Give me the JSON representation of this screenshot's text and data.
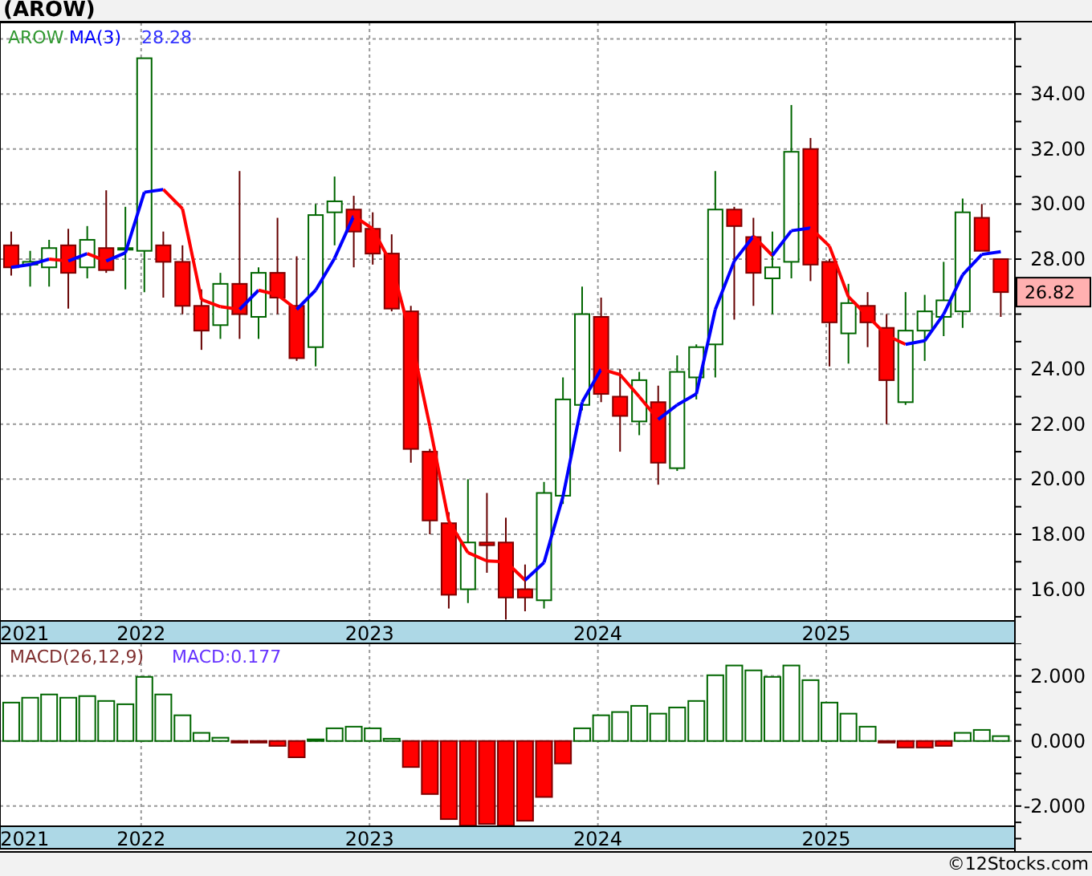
{
  "title": "(AROW)",
  "price_panel": {
    "legend": [
      {
        "text": "AROW",
        "color": "#339933"
      },
      {
        "text": "28.28",
        "color": "#3333ff"
      }
    ],
    "last_price": "26.82",
    "chart_data": {
      "type": "candlestick",
      "grid": true,
      "ylim": [
        14.85,
        36.6
      ],
      "xlim": [
        2021.382,
        2025.826
      ],
      "yticks": [
        {
          "value": 16,
          "label": "16.00"
        },
        {
          "value": 18,
          "label": "18.00"
        },
        {
          "value": 20,
          "label": "20.00"
        },
        {
          "value": 22,
          "label": "22.00"
        },
        {
          "value": 24,
          "label": "24.00"
        },
        {
          "value": 28,
          "label": "28.00"
        },
        {
          "value": 30,
          "label": "30.00"
        },
        {
          "value": 32,
          "label": "32.00"
        },
        {
          "value": 34,
          "label": "34.00"
        }
      ],
      "xticks": [
        {
          "value": 2021.49,
          "label": "2021"
        },
        {
          "value": 2022,
          "label": "2022"
        },
        {
          "value": 2023,
          "label": "2023"
        },
        {
          "value": 2024,
          "label": "2024"
        },
        {
          "value": 2025,
          "label": "2025"
        }
      ],
      "x": [
        2021.417,
        2021.5,
        2021.583,
        2021.667,
        2021.75,
        2021.833,
        2021.917,
        2022,
        2022.083,
        2022.167,
        2022.25,
        2022.333,
        2022.417,
        2022.5,
        2022.583,
        2022.667,
        2022.75,
        2022.833,
        2022.917,
        2023,
        2023.083,
        2023.167,
        2023.25,
        2023.333,
        2023.417,
        2023.5,
        2023.583,
        2023.667,
        2023.75,
        2023.833,
        2023.917,
        2024,
        2024.083,
        2024.167,
        2024.25,
        2024.333,
        2024.417,
        2024.5,
        2024.583,
        2024.667,
        2024.75,
        2024.833,
        2024.917,
        2025,
        2025.083,
        2025.167,
        2025.25,
        2025.333,
        2025.417,
        2025.5,
        2025.583,
        2025.667,
        2025.75
      ],
      "ohlc": [
        [
          28.5,
          29.0,
          27.4,
          27.7
        ],
        [
          27.8,
          28.3,
          27.0,
          27.9
        ],
        [
          27.7,
          28.7,
          27.0,
          28.4
        ],
        [
          28.5,
          29.1,
          26.2,
          27.5
        ],
        [
          27.7,
          29.2,
          27.3,
          28.7
        ],
        [
          28.4,
          30.5,
          27.5,
          27.6
        ],
        [
          28.35,
          29.9,
          26.9,
          28.4
        ],
        [
          28.3,
          35.3,
          26.8,
          35.3
        ],
        [
          28.5,
          29.0,
          26.6,
          27.9
        ],
        [
          27.9,
          28.5,
          26.0,
          26.3
        ],
        [
          26.3,
          26.9,
          24.7,
          25.4
        ],
        [
          25.6,
          27.5,
          25.1,
          27.1
        ],
        [
          27.1,
          31.2,
          25.1,
          26.0
        ],
        [
          25.9,
          27.7,
          25.1,
          27.5
        ],
        [
          27.5,
          29.5,
          26.0,
          26.6
        ],
        [
          26.3,
          28.1,
          24.3,
          24.4
        ],
        [
          24.8,
          30.0,
          24.1,
          29.6
        ],
        [
          29.7,
          31.0,
          28.5,
          30.1
        ],
        [
          29.8,
          30.3,
          27.7,
          29.0
        ],
        [
          29.1,
          29.7,
          27.8,
          28.2
        ],
        [
          28.2,
          28.9,
          26.1,
          26.2
        ],
        [
          26.1,
          26.3,
          20.6,
          21.1
        ],
        [
          21.0,
          21.1,
          18.0,
          18.5
        ],
        [
          18.4,
          18.8,
          15.3,
          15.8
        ],
        [
          16.0,
          20.0,
          15.5,
          17.7
        ],
        [
          17.7,
          19.5,
          16.6,
          17.6
        ],
        [
          17.7,
          18.6,
          14.9,
          15.7
        ],
        [
          16.0,
          16.9,
          15.2,
          15.7
        ],
        [
          15.6,
          19.9,
          15.3,
          19.5
        ],
        [
          19.4,
          23.7,
          19.1,
          22.9
        ],
        [
          22.7,
          27.0,
          22.5,
          26.0
        ],
        [
          25.9,
          26.6,
          22.8,
          23.1
        ],
        [
          23.0,
          24.0,
          21.0,
          22.3
        ],
        [
          22.1,
          23.9,
          21.6,
          23.6
        ],
        [
          22.8,
          23.4,
          19.8,
          20.6
        ],
        [
          20.4,
          24.5,
          20.3,
          23.9
        ],
        [
          23.7,
          24.9,
          22.9,
          24.8
        ],
        [
          24.9,
          31.2,
          23.7,
          29.8
        ],
        [
          29.8,
          29.9,
          25.8,
          29.2
        ],
        [
          28.8,
          29.5,
          26.3,
          27.5
        ],
        [
          27.3,
          29.0,
          26.0,
          27.7
        ],
        [
          27.9,
          33.6,
          27.3,
          31.9
        ],
        [
          32.0,
          32.4,
          27.2,
          27.8
        ],
        [
          27.9,
          28.0,
          24.1,
          25.7
        ],
        [
          25.3,
          27.1,
          24.2,
          26.4
        ],
        [
          26.3,
          26.8,
          24.8,
          25.7
        ],
        [
          25.5,
          26.0,
          22.0,
          23.6
        ],
        [
          22.8,
          26.8,
          22.7,
          25.4
        ],
        [
          25.4,
          26.7,
          24.3,
          26.1
        ],
        [
          25.9,
          27.9,
          25.2,
          26.5
        ],
        [
          26.1,
          30.2,
          25.5,
          29.7
        ],
        [
          29.5,
          30.0,
          28.3,
          28.3
        ],
        [
          28.0,
          28.0,
          25.9,
          26.8
        ]
      ],
      "series": [
        {
          "name": "MA(3)",
          "type": "line",
          "color": "#0000ff",
          "values": [
            27.7,
            27.8,
            28.0,
            27.93,
            28.2,
            27.93,
            28.23,
            30.43,
            30.53,
            null,
            null,
            null,
            26.17,
            26.87,
            null,
            26.17,
            26.87,
            28.03,
            29.57,
            null,
            null,
            null,
            null,
            null,
            null,
            null,
            null,
            16.33,
            16.97,
            19.37,
            22.8,
            24.0,
            null,
            null,
            22.17,
            22.7,
            23.1,
            26.17,
            27.93,
            28.83,
            28.13,
            29.03,
            29.13,
            null,
            null,
            null,
            null,
            24.9,
            25.03,
            26.0,
            27.43,
            28.17,
            28.27
          ]
        },
        {
          "type": "line",
          "color": "#ff0000",
          "values": [
            null,
            null,
            28.0,
            27.93,
            28.2,
            27.93,
            null,
            null,
            30.53,
            29.83,
            26.53,
            26.27,
            26.17,
            26.87,
            26.7,
            26.17,
            null,
            null,
            29.57,
            29.1,
            27.8,
            25.17,
            21.93,
            18.47,
            17.33,
            17.03,
            17.0,
            16.33,
            null,
            null,
            null,
            24.0,
            23.8,
            23.0,
            22.17,
            null,
            null,
            null,
            null,
            28.83,
            28.13,
            null,
            29.13,
            28.47,
            26.63,
            25.93,
            25.23,
            24.9,
            null,
            null,
            null,
            null,
            null
          ]
        }
      ]
    }
  },
  "macd_panel": {
    "legend": [
      {
        "text": "MACD(26,12,9)",
        "color": "#803030"
      },
      {
        "text": "MACD:0.177",
        "color": "#6633ff"
      }
    ],
    "chart_data": {
      "type": "bar",
      "grid": true,
      "ylim": [
        -2.62,
        3.0
      ],
      "xlim": [
        2021.382,
        2025.826
      ],
      "yticks": [
        {
          "value": 2,
          "label": "2.000"
        },
        {
          "value": 0,
          "label": "0.000"
        },
        {
          "value": -2,
          "label": "-2.000"
        }
      ],
      "xticks": [
        {
          "value": 2021.49,
          "label": "2021"
        },
        {
          "value": 2022,
          "label": "2022"
        },
        {
          "value": 2023,
          "label": "2023"
        },
        {
          "value": 2024,
          "label": "2024"
        },
        {
          "value": 2025,
          "label": "2025"
        }
      ],
      "x": [
        2021.417,
        2021.5,
        2021.583,
        2021.667,
        2021.75,
        2021.833,
        2021.917,
        2022,
        2022.083,
        2022.167,
        2022.25,
        2022.333,
        2022.417,
        2022.5,
        2022.583,
        2022.667,
        2022.75,
        2022.833,
        2022.917,
        2023,
        2023.083,
        2023.167,
        2023.25,
        2023.333,
        2023.417,
        2023.5,
        2023.583,
        2023.667,
        2023.75,
        2023.833,
        2023.917,
        2024,
        2024.083,
        2024.167,
        2024.25,
        2024.333,
        2024.417,
        2024.5,
        2024.583,
        2024.667,
        2024.75,
        2024.833,
        2024.917,
        2025,
        2025.083,
        2025.167,
        2025.25,
        2025.333,
        2025.417,
        2025.5,
        2025.583,
        2025.667,
        2025.75
      ],
      "values": [
        1.18,
        1.33,
        1.43,
        1.33,
        1.38,
        1.23,
        1.13,
        1.97,
        1.43,
        0.79,
        0.25,
        0.1,
        -0.03,
        -0.03,
        -0.15,
        -0.5,
        0.05,
        0.39,
        0.44,
        0.39,
        0.07,
        -0.8,
        -1.63,
        -2.4,
        -2.6,
        -2.55,
        -2.6,
        -2.45,
        -1.72,
        -0.69,
        0.39,
        0.79,
        0.89,
        1.08,
        0.84,
        1.03,
        1.23,
        2.02,
        2.32,
        2.17,
        1.97,
        2.32,
        1.87,
        1.18,
        0.84,
        0.44,
        -0.02,
        -0.2,
        -0.2,
        -0.15,
        0.25,
        0.34,
        0.15
      ]
    }
  },
  "footer": "©12Stocks.com"
}
